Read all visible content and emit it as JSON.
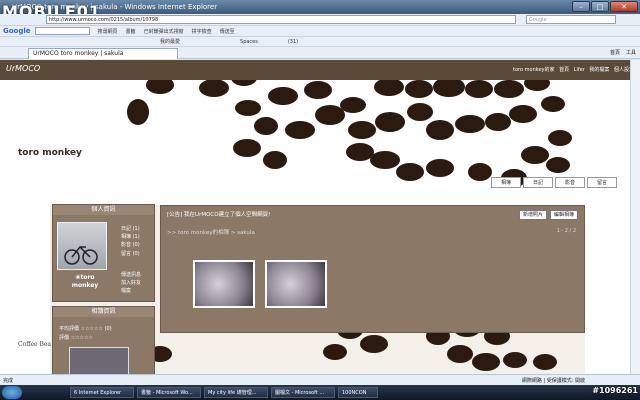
{
  "window": {
    "title": "UrMOCO toro monkey | sakula - Windows Internet Explorer",
    "watermark_logo": "MOBILE01",
    "controls": [
      "–",
      "□",
      "✕"
    ]
  },
  "address_bar": {
    "url": "http://www.urmoco.com/0215/album/10798",
    "search_placeholder": "Google"
  },
  "google_toolbar": {
    "label": "Google",
    "items": [
      "搜尋網頁",
      "書籤",
      "已封鎖彈出式視窗",
      "拼字檢查",
      "傳送至"
    ]
  },
  "links_bar": {
    "items": [
      "我的最愛",
      "Spaces",
      "(31)"
    ]
  },
  "tab": {
    "label": "UrMOCO toro monkey | sakula"
  },
  "tab_tools": [
    "首頁",
    "工具"
  ],
  "site": {
    "brand": "UrMOCO",
    "top_nav": [
      "toro monkey的家",
      "首頁",
      "Lifer",
      "我的檔案",
      "個人設定"
    ],
    "title": "toro monkey",
    "nav_tabs": [
      "相簿",
      "日記",
      "影音",
      "留言"
    ],
    "coffee_label": "Coffee Bea"
  },
  "profile_panel": {
    "header": "個人資訊",
    "name": "❀toro monkey",
    "links": [
      "日記 (1)",
      "相簿 (1)",
      "影音 (0)",
      "留言 (0)"
    ],
    "actions": [
      "傳送訊息",
      "加入好友",
      "檔案"
    ]
  },
  "related_panel": {
    "header": "相簿資訊",
    "rows": [
      "平均評價 ☆☆☆☆☆ (0)",
      "評價 ☆☆☆☆☆"
    ]
  },
  "album": {
    "announcement": "[公告] 我在UrMOCO建立了個人空間網頁!",
    "buttons": [
      "新增照片",
      "編輯相簿"
    ],
    "breadcrumb": ">> toro monkey的相簿 > sakula",
    "pager": "1 - 2 / 2"
  },
  "status_bar": {
    "status": "完成",
    "zone": "網際網路 | 受保護模式: 開啟"
  },
  "taskbar": {
    "tasks": [
      "6 Internet Explorer",
      "書籤 - Microsoft Wo...",
      "My city life 總管理...",
      "圖檔文 - Microsoft ...",
      "100NCON"
    ],
    "watermark": "#1096261"
  }
}
